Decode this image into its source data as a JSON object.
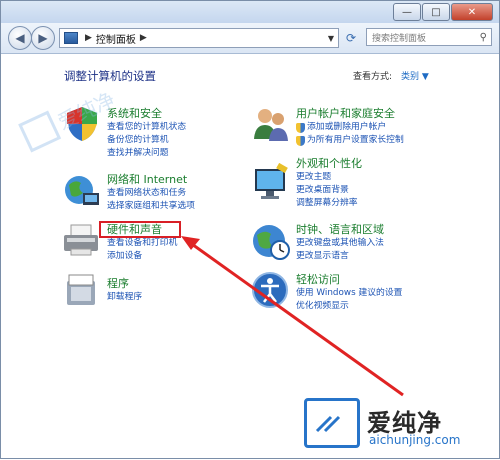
{
  "window": {
    "caption_buttons": {
      "minimize": "—",
      "maximize": "□",
      "close": "✕"
    }
  },
  "addressbar": {
    "breadcrumb": "控制面板",
    "search_placeholder": "搜索控制面板"
  },
  "header": {
    "title": "调整计算机的设置",
    "view_by_label": "查看方式:",
    "view_by_value": "类别 ▼"
  },
  "categories": {
    "system": {
      "title": "系统和安全",
      "links": [
        "查看您的计算机状态",
        "备份您的计算机",
        "查找并解决问题"
      ]
    },
    "network": {
      "title": "网络和 Internet",
      "links": [
        "查看网络状态和任务",
        "选择家庭组和共享选项"
      ]
    },
    "hardware": {
      "title": "硬件和声音",
      "links": [
        "查看设备和打印机",
        "添加设备"
      ]
    },
    "programs": {
      "title": "程序",
      "links": [
        "卸载程序"
      ]
    },
    "users": {
      "title": "用户帐户和家庭安全",
      "links": [
        "添加或删除用户帐户",
        "为所有用户设置家长控制"
      ]
    },
    "appearance": {
      "title": "外观和个性化",
      "links": [
        "更改主题",
        "更改桌面背景",
        "调整屏幕分辨率"
      ]
    },
    "clock": {
      "title": "时钟、语言和区域",
      "links": [
        "更改键盘或其他输入法",
        "更改显示语言"
      ]
    },
    "ease": {
      "title": "轻松访问",
      "links": [
        "使用 Windows 建议的设置",
        "优化视频显示"
      ]
    }
  },
  "watermark": {
    "brand": "爱纯净",
    "url": "aichunjing.com",
    "side_text": "爱纯净"
  },
  "colors": {
    "accent_link": "#1e54b4",
    "category_title": "#1a7d2e",
    "highlight": "#d81f26"
  }
}
